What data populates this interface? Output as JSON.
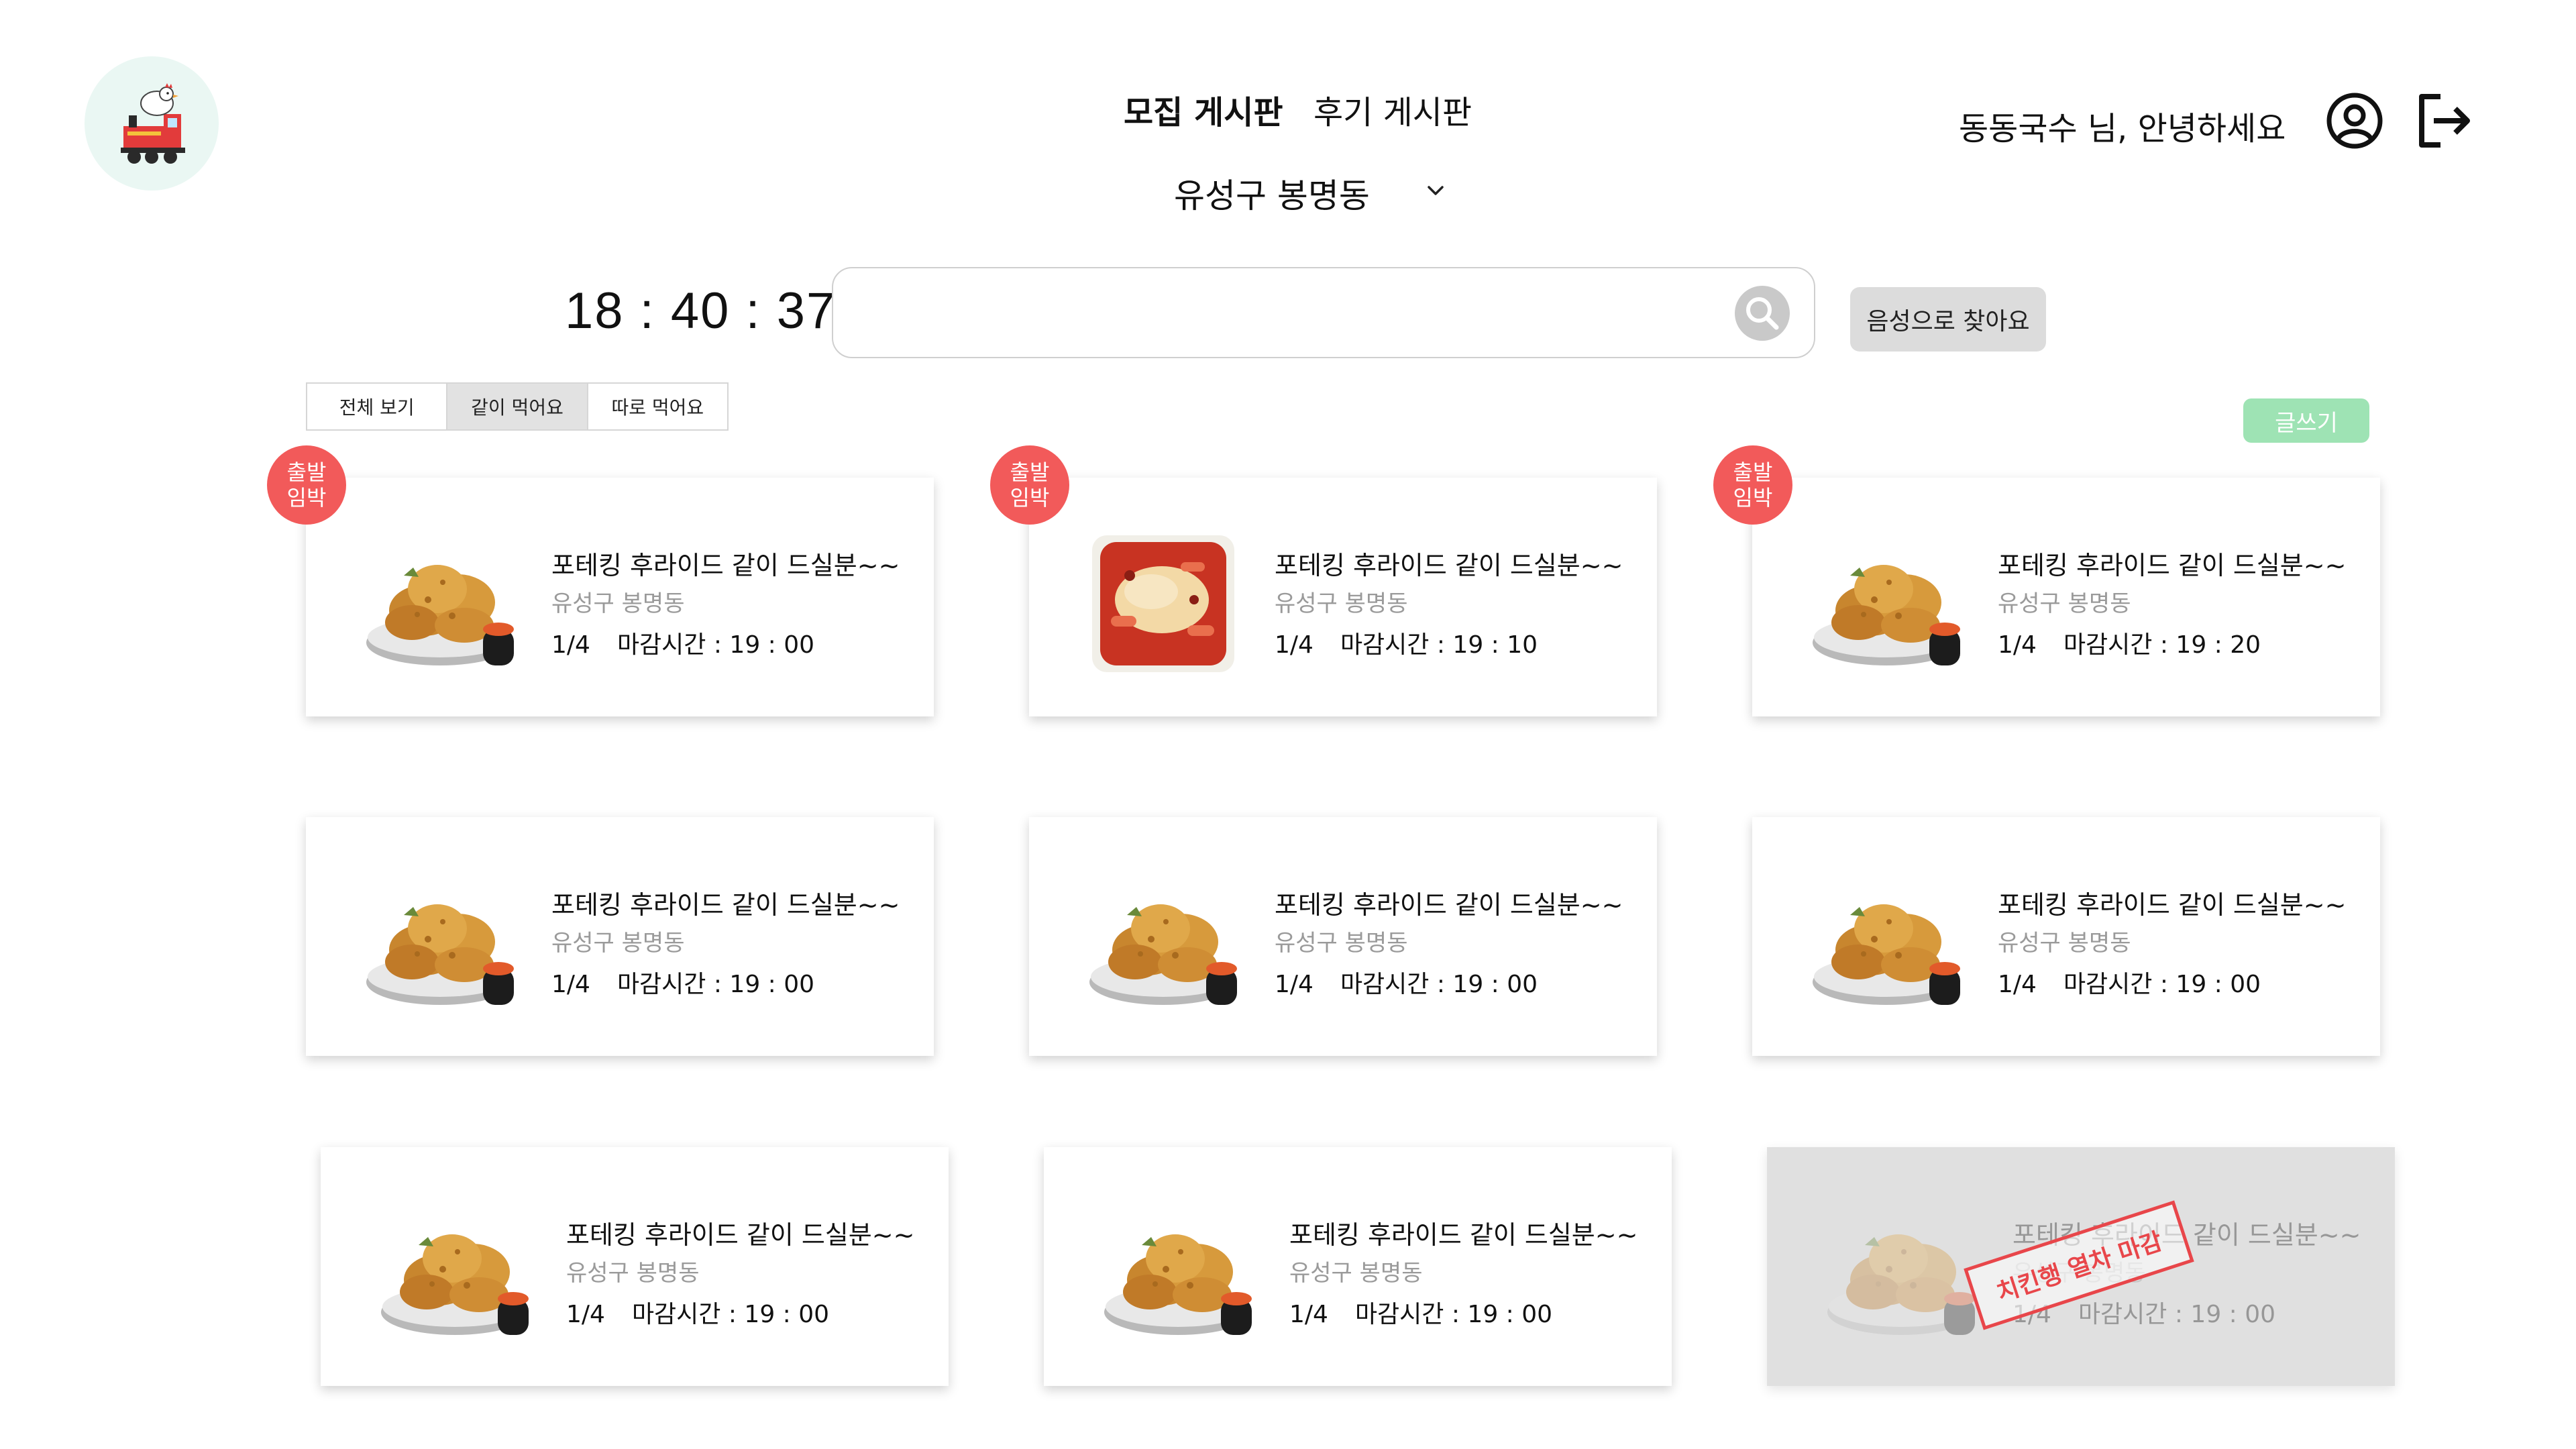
{
  "header": {
    "logo_name": "chicken-train-logo",
    "nav": {
      "recruit_board": "모집 게시판",
      "review_board": "후기 게시판"
    },
    "region": "유성구 봉명동",
    "greeting": "동동국수 님, 안녕하세요"
  },
  "toolbar": {
    "clock": "18 : 40 : 37",
    "search_placeholder": "",
    "voice_search": "음성으로 찾아요",
    "write": "글쓰기"
  },
  "filters": {
    "all": "전체 보기",
    "together": "같이 먹어요",
    "separate": "따로 먹어요",
    "active": "같이 먹어요"
  },
  "colors": {
    "badge": "#f25a5a",
    "write_button": "#9ee3b4",
    "stamp": "#e8464a"
  },
  "cards": [
    {
      "title": "포테킹 후라이드 같이 드실분~~",
      "area": "유성구 봉명동",
      "count": "1/4",
      "deadline": "마감시간 : 19 : 00",
      "badge": "출발\n임박",
      "image": "fried-chicken",
      "closed": false
    },
    {
      "title": "포테킹 후라이드 같이 드실분~~",
      "area": "유성구 봉명동",
      "count": "1/4",
      "deadline": "마감시간 : 19 : 10",
      "badge": "출발\n임박",
      "image": "tteokbokki",
      "closed": false
    },
    {
      "title": "포테킹 후라이드 같이 드실분~~",
      "area": "유성구 봉명동",
      "count": "1/4",
      "deadline": "마감시간 : 19 : 20",
      "badge": "출발\n임박",
      "image": "fried-chicken",
      "closed": false
    },
    {
      "title": "포테킹 후라이드 같이 드실분~~",
      "area": "유성구 봉명동",
      "count": "1/4",
      "deadline": "마감시간 : 19 : 00",
      "image": "fried-chicken",
      "closed": false
    },
    {
      "title": "포테킹 후라이드 같이 드실분~~",
      "area": "유성구 봉명동",
      "count": "1/4",
      "deadline": "마감시간 : 19 : 00",
      "image": "fried-chicken",
      "closed": false
    },
    {
      "title": "포테킹 후라이드 같이 드실분~~",
      "area": "유성구 봉명동",
      "count": "1/4",
      "deadline": "마감시간 : 19 : 00",
      "image": "fried-chicken",
      "closed": false
    },
    {
      "title": "포테킹 후라이드 같이 드실분~~",
      "area": "유성구 봉명동",
      "count": "1/4",
      "deadline": "마감시간 : 19 : 00",
      "image": "fried-chicken",
      "closed": false
    },
    {
      "title": "포테킹 후라이드 같이 드실분~~",
      "area": "유성구 봉명동",
      "count": "1/4",
      "deadline": "마감시간 : 19 : 00",
      "image": "fried-chicken",
      "closed": false
    },
    {
      "title": "포테킹 후라이드 같이 드실분~~",
      "area": "유성구 봉명동",
      "count": "1/4",
      "deadline": "마감시간 : 19 : 00",
      "image": "fried-chicken",
      "closed": true,
      "stamp": "치킨행 열차 마감"
    }
  ]
}
